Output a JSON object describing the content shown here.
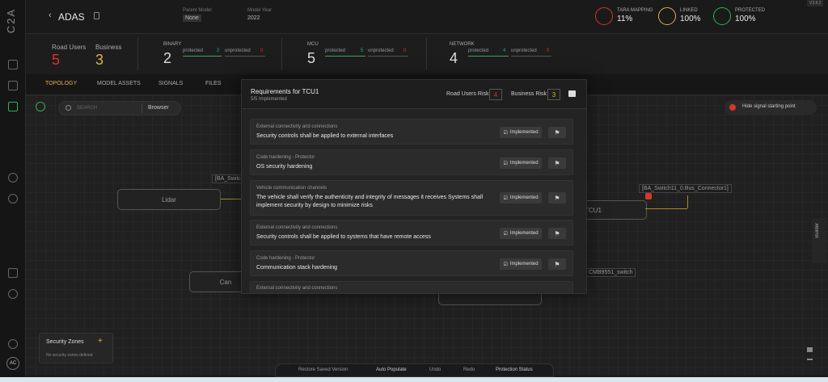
{
  "app": {
    "logo": "C2A"
  },
  "header": {
    "project_title": "ADAS",
    "parent_model_label": "Parent Model",
    "parent_model_value": "None",
    "model_year_label": "Model Year",
    "model_year_value": "2022",
    "tara_mapping_label": "TARA MAPPING",
    "tara_mapping_value": "11%",
    "linked_label": "LINKED",
    "linked_value": "100%",
    "protected_label": "PROTECTED",
    "protected_value": "100%",
    "corner_badge": "V3.8.2"
  },
  "stats": {
    "road_users_label": "Road Users",
    "road_users_value": "5",
    "business_label": "Business",
    "business_value": "3",
    "binary_label": "BINARY",
    "binary_value": "2",
    "binary_protected_label": "protected",
    "binary_protected": "2",
    "binary_unprotected_label": "unprotected",
    "binary_unprotected": "0",
    "mcu_label": "MCU",
    "mcu_value": "5",
    "mcu_protected_label": "protected",
    "mcu_protected": "5",
    "mcu_unprotected_label": "unprotected",
    "mcu_unprotected": "0",
    "network_label": "NETWORK",
    "network_value": "4",
    "network_protected_label": "protected",
    "network_protected": "4",
    "network_unprotected_label": "unprotected",
    "network_unprotected": "0"
  },
  "tabs": [
    "TOPOLOGY",
    "MODEL ASSETS",
    "SIGNALS",
    "FILES"
  ],
  "canvas": {
    "search_placeholder": "SEARCH",
    "browser_label": "Browser",
    "hide_signal_label": "Hide signal starting point",
    "builder_label": "Builder",
    "nodes": [
      "Lidar",
      "Can",
      "TCU1"
    ],
    "edge_labels": [
      "[BA_Switch",
      "[BA_Switch11_0.Bus_Connector1]",
      "CMB9551_switch"
    ]
  },
  "security_zones": {
    "title": "Security Zones",
    "add": "+",
    "empty": "No security zones defined"
  },
  "modal": {
    "title": "Requirements for TCU1",
    "subtitle": "5/5 Implemented",
    "road_users_risk_label": "Road Users Risk",
    "road_users_risk_value": "4",
    "business_risk_label": "Business Risk",
    "business_risk_value": "3",
    "implemented_label": "Implemented",
    "requirements": [
      {
        "category": "External connectivity and connections",
        "text": "Security controls shall be applied to external interfaces"
      },
      {
        "category": "Code hardening - Protector",
        "text": "OS security hardening"
      },
      {
        "category": "Vehicle communication channels",
        "text": "The vehicle shall verify the authenticity and integrity of messages it receives Systems shall implement security by design to minimize risks"
      },
      {
        "category": "External connectivity and connections",
        "text": "Security controls shall be applied to systems that have remote access"
      },
      {
        "category": "Code hardening - Protector",
        "text": "Communication stack hardening"
      },
      {
        "category": "External connectivity and connections",
        "text": ""
      }
    ]
  },
  "bottombar": {
    "restore": "Restore Saved Version",
    "auto_populate": "Auto Populate",
    "undo": "Undo",
    "redo": "Redo",
    "protection_status": "Protection Status"
  },
  "user": {
    "initials": "AC"
  },
  "colors": {
    "red": "#d9342b",
    "yellow": "#e0b33a",
    "green": "#2fae5b",
    "accent": "#e0b33a"
  }
}
